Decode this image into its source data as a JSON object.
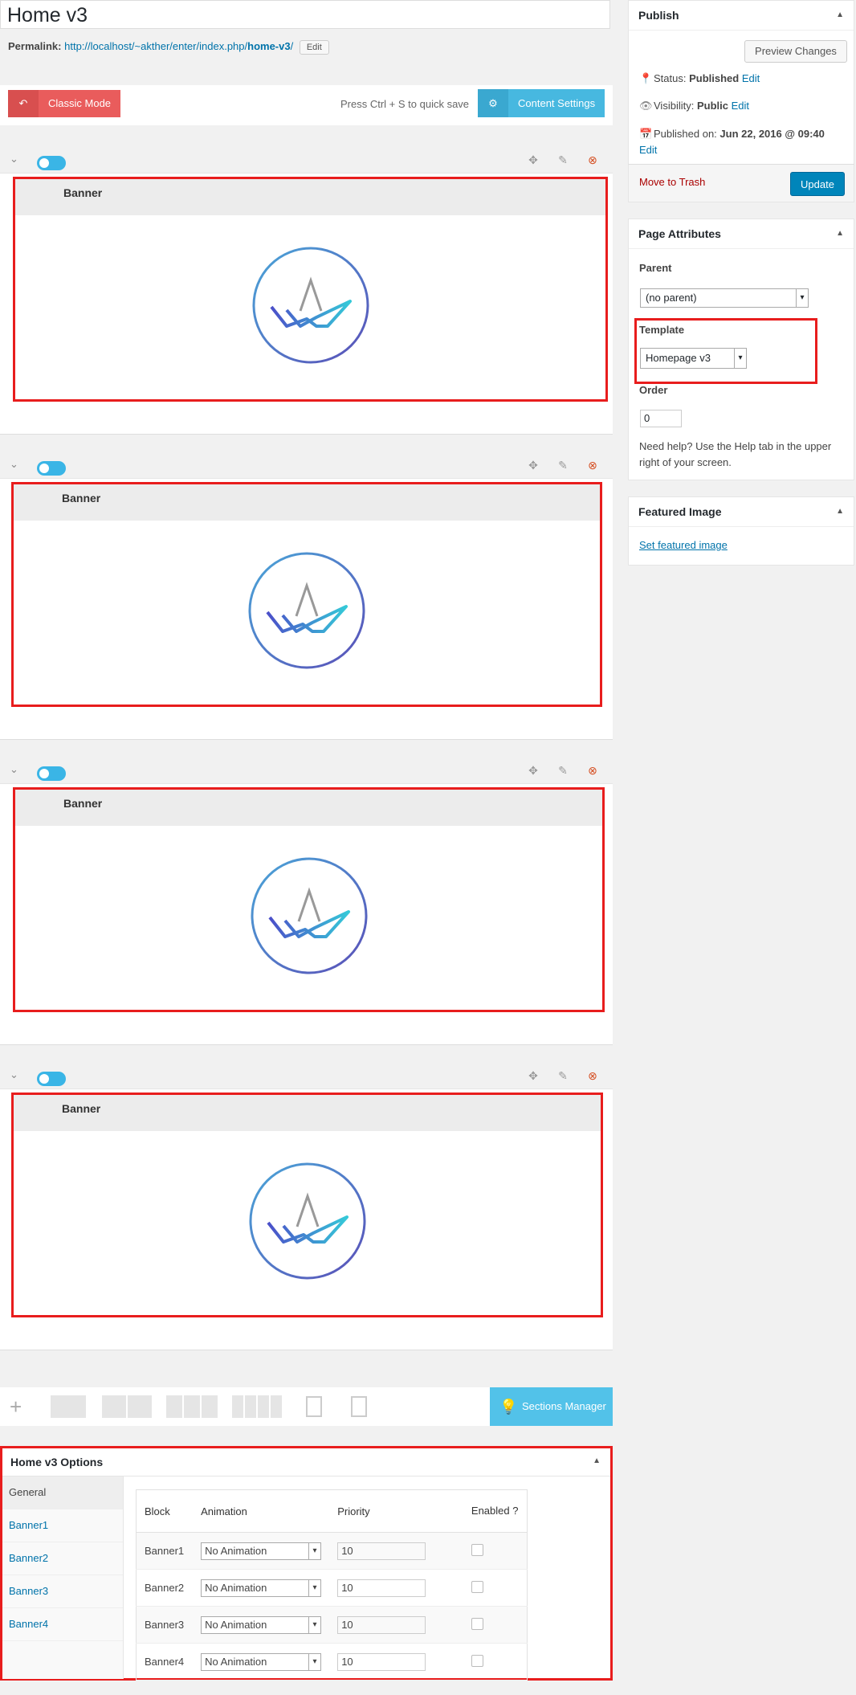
{
  "page_title": "Home v3",
  "permalink": {
    "label": "Permalink:",
    "url_prefix": "http://localhost/~akther/enter/index.php/",
    "url_slug": "home-v3",
    "url_suffix": "/",
    "edit_label": "Edit"
  },
  "mode_bar": {
    "classic_label": "Classic Mode",
    "quick_save": "Press Ctrl + S to quick save",
    "content_settings_label": "Content Settings"
  },
  "sections": [
    {
      "banner_label": "Banner"
    },
    {
      "banner_label": "Banner"
    },
    {
      "banner_label": "Banner"
    },
    {
      "banner_label": "Banner"
    }
  ],
  "bottom_bar": {
    "sections_manager_label": "Sections Manager"
  },
  "options": {
    "title": "Home v3 Options",
    "side_items": [
      "General",
      "Banner1",
      "Banner2",
      "Banner3",
      "Banner4"
    ],
    "columns": [
      "Block",
      "Animation",
      "Priority",
      "Enabled ?"
    ],
    "rows": [
      {
        "block": "Banner1",
        "animation": "No Animation",
        "priority": "10"
      },
      {
        "block": "Banner2",
        "animation": "No Animation",
        "priority": "10"
      },
      {
        "block": "Banner3",
        "animation": "No Animation",
        "priority": "10"
      },
      {
        "block": "Banner4",
        "animation": "No Animation",
        "priority": "10"
      }
    ]
  },
  "publish": {
    "title": "Publish",
    "preview_label": "Preview Changes",
    "status_label": "Status:",
    "status_value": "Published",
    "visibility_label": "Visibility:",
    "visibility_value": "Public",
    "published_label": "Published on:",
    "published_value": "Jun 22, 2016 @ 09:40",
    "edit_label": "Edit",
    "trash_label": "Move to Trash",
    "update_label": "Update"
  },
  "page_attributes": {
    "title": "Page Attributes",
    "parent_label": "Parent",
    "parent_value": "(no parent)",
    "template_label": "Template",
    "template_value": "Homepage v3",
    "order_label": "Order",
    "order_value": "0",
    "help_text": "Need help? Use the Help tab in the upper right of your screen."
  },
  "featured_image": {
    "title": "Featured Image",
    "link_label": "Set featured image"
  },
  "colors": {
    "highlight": "#e81d1d",
    "accent_blue": "#47b8e0",
    "classic_red": "#e95c5c",
    "update_blue": "#0085ba"
  }
}
